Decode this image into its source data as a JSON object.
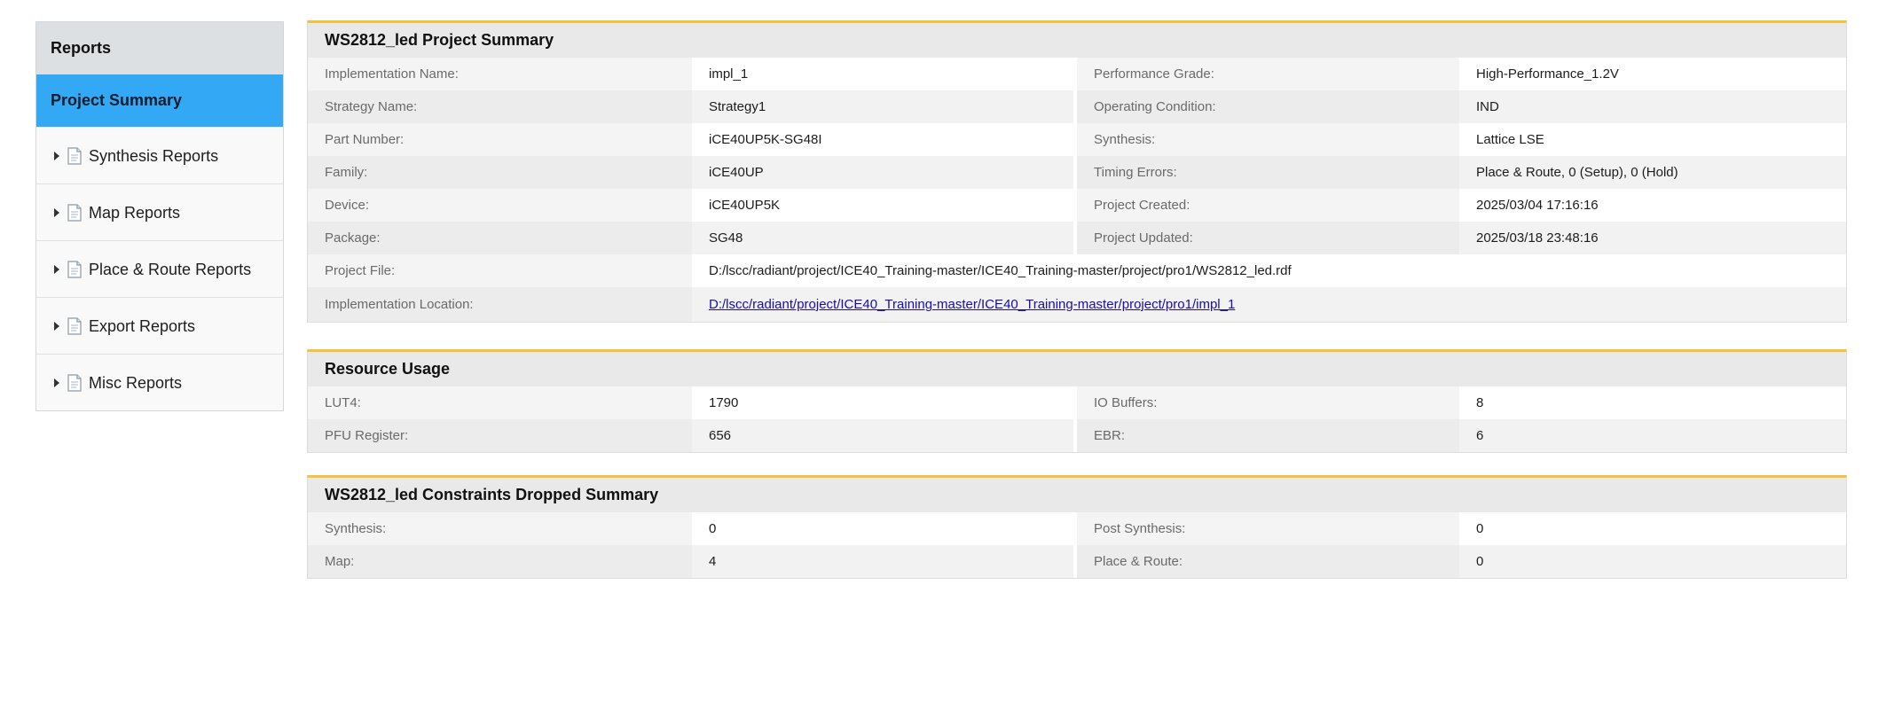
{
  "sidebar": {
    "header": "Reports",
    "active_item": "Project Summary",
    "items": [
      {
        "label": "Synthesis Reports"
      },
      {
        "label": "Map Reports"
      },
      {
        "label": "Place & Route Reports"
      },
      {
        "label": "Export Reports"
      },
      {
        "label": "Misc Reports"
      }
    ]
  },
  "project_summary": {
    "title": "WS2812_led Project Summary",
    "rows": [
      {
        "l1": "Implementation Name:",
        "v1": "impl_1",
        "l2": "Performance Grade:",
        "v2": "High-Performance_1.2V"
      },
      {
        "l1": "Strategy Name:",
        "v1": "Strategy1",
        "l2": "Operating Condition:",
        "v2": "IND"
      },
      {
        "l1": "Part Number:",
        "v1": "iCE40UP5K-SG48I",
        "l2": "Synthesis:",
        "v2": "Lattice LSE"
      },
      {
        "l1": "Family:",
        "v1": "iCE40UP",
        "l2": "Timing Errors:",
        "v2": "Place & Route, 0 (Setup), 0 (Hold)"
      },
      {
        "l1": "Device:",
        "v1": "iCE40UP5K",
        "l2": "Project Created:",
        "v2": "2025/03/04 17:16:16"
      },
      {
        "l1": "Package:",
        "v1": "SG48",
        "l2": "Project Updated:",
        "v2": "2025/03/18 23:48:16"
      }
    ],
    "project_file_label": "Project File:",
    "project_file_value": "D:/lscc/radiant/project/ICE40_Training-master/ICE40_Training-master/project/pro1/WS2812_led.rdf",
    "impl_location_label": "Implementation Location:",
    "impl_location_value": "D:/lscc/radiant/project/ICE40_Training-master/ICE40_Training-master/project/pro1/impl_1"
  },
  "resource_usage": {
    "title": "Resource Usage",
    "rows": [
      {
        "l1": "LUT4:",
        "v1": "1790",
        "l2": "IO Buffers:",
        "v2": "8"
      },
      {
        "l1": "PFU Register:",
        "v1": "656",
        "l2": "EBR:",
        "v2": "6"
      }
    ]
  },
  "constraints_dropped": {
    "title": "WS2812_led Constraints Dropped Summary",
    "rows": [
      {
        "l1": "Synthesis:",
        "v1": "0",
        "l2": "Post Synthesis:",
        "v2": "0"
      },
      {
        "l1": "Map:",
        "v1": "4",
        "l2": "Place & Route:",
        "v2": "0"
      }
    ]
  },
  "colors": {
    "active_tab": "#33a9f5",
    "panel_accent": "#f6c13c",
    "link": "#1a0dab"
  },
  "icons": {
    "expand": "caret-right-icon",
    "report": "document-icon"
  }
}
